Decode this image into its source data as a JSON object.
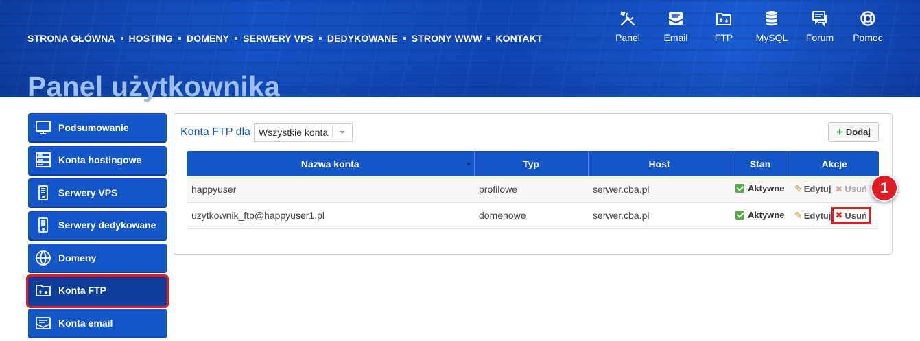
{
  "topnav": [
    "STRONA GŁÓWNA",
    "HOSTING",
    "DOMENY",
    "SERWERY VPS",
    "DEDYKOWANE",
    "STRONY WWW",
    "KONTAKT"
  ],
  "iconnav": [
    {
      "label": "Panel",
      "icon": "tools-icon"
    },
    {
      "label": "Email",
      "icon": "email-icon"
    },
    {
      "label": "FTP",
      "icon": "ftp-folder-icon"
    },
    {
      "label": "MySQL",
      "icon": "database-icon"
    },
    {
      "label": "Forum",
      "icon": "forum-icon"
    },
    {
      "label": "Pomoc",
      "icon": "lifebuoy-icon"
    }
  ],
  "page_title": "Panel użytkownika",
  "sidebar": [
    {
      "label": "Podsumowanie",
      "icon": "monitor-icon"
    },
    {
      "label": "Konta hostingowe",
      "icon": "server-rack-icon"
    },
    {
      "label": "Serwery VPS",
      "icon": "server-icon"
    },
    {
      "label": "Serwery dedykowane",
      "icon": "server-icon"
    },
    {
      "label": "Domeny",
      "icon": "www-globe-icon"
    },
    {
      "label": "Konta FTP",
      "icon": "ftp-folder-icon",
      "active": true
    },
    {
      "label": "Konta email",
      "icon": "email-icon"
    }
  ],
  "main": {
    "filter_label": "Konta FTP dla",
    "filter_value": "Wszystkie konta",
    "add_label": "Dodaj",
    "columns": [
      "Nazwa konta",
      "Typ",
      "Host",
      "Stan",
      "Akcje"
    ],
    "rows": [
      {
        "name": "happyuser",
        "type": "profilowe",
        "host": "serwer.cba.pl",
        "status": "Aktywne",
        "edit": "Edytuj",
        "delete": "Usuń",
        "delete_enabled": false
      },
      {
        "name": "uzytkownik_ftp@happyuser1.pl",
        "type": "domenowe",
        "host": "serwer.cba.pl",
        "status": "Aktywne",
        "edit": "Edytuj",
        "delete": "Usuń",
        "delete_enabled": true
      }
    ]
  },
  "annotation": {
    "badge": "1"
  },
  "colors": {
    "primary": "#1456c8",
    "highlight": "#e31c23",
    "title": "#9cc0f0",
    "success": "#5aa84a"
  }
}
